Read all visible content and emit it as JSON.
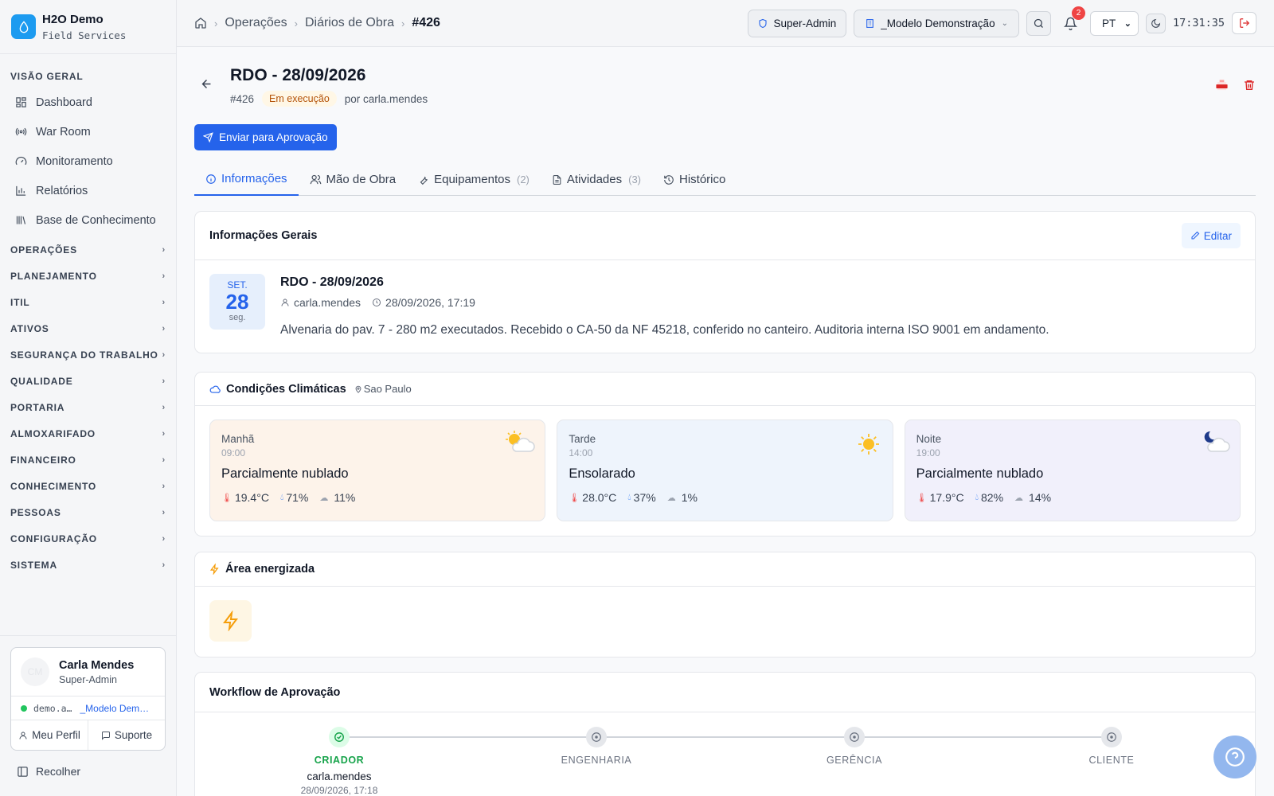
{
  "brand": {
    "name": "H2O Demo",
    "subtitle": "Field Services"
  },
  "sidebar": {
    "overview_label": "VISÃO GERAL",
    "overview_items": [
      {
        "label": "Dashboard",
        "icon": "dashboard-icon"
      },
      {
        "label": "War Room",
        "icon": "broadcast-icon"
      },
      {
        "label": "Monitoramento",
        "icon": "gauge-icon"
      },
      {
        "label": "Relatórios",
        "icon": "bar-chart-icon"
      },
      {
        "label": "Base de Conhecimento",
        "icon": "library-icon"
      }
    ],
    "sections": [
      "OPERAÇÕES",
      "PLANEJAMENTO",
      "ITIL",
      "ATIVOS",
      "SEGURANÇA DO TRABALHO",
      "QUALIDADE",
      "PORTARIA",
      "ALMOXARIFADO",
      "FINANCEIRO",
      "CONHECIMENTO",
      "PESSOAS",
      "CONFIGURAÇÃO",
      "SISTEMA"
    ],
    "user": {
      "initials": "CM",
      "name": "Carla Mendes",
      "role": "Super-Admin",
      "account": "demo.a…",
      "tenant": "_Modelo Dem…",
      "profile_link": "Meu Perfil",
      "support_link": "Suporte"
    },
    "collapse_label": "Recolher"
  },
  "topbar": {
    "breadcrumb": [
      "Operações",
      "Diários de Obra",
      "#426"
    ],
    "role_chip": "Super-Admin",
    "tenant_chip": "_Modelo Demonstração",
    "notifications_count": "2",
    "language": "PT",
    "clock": "17:31:35"
  },
  "record": {
    "title": "RDO - 28/09/2026",
    "id": "#426",
    "status": "Em execução",
    "author": "por carla.mendes",
    "submit_label": "Enviar para Aprovação"
  },
  "tabs": [
    {
      "label": "Informações",
      "count": ""
    },
    {
      "label": "Mão de Obra",
      "count": ""
    },
    {
      "label": "Equipamentos",
      "count": "(2)"
    },
    {
      "label": "Atividades",
      "count": "(3)"
    },
    {
      "label": "Histórico",
      "count": ""
    }
  ],
  "general_info": {
    "heading": "Informações Gerais",
    "edit_label": "Editar",
    "date_month": "SET.",
    "date_day": "28",
    "date_weekday": "seg.",
    "title": "RDO - 28/09/2026",
    "user": "carla.mendes",
    "timestamp": "28/09/2026, 17:19",
    "description": "Alvenaria do pav. 7 - 280 m2 executados. Recebido o CA-50 da NF 45218, conferido no canteiro. Auditoria interna ISO 9001 em andamento."
  },
  "weather": {
    "heading": "Condições Climáticas",
    "location": "Sao Paulo",
    "periods": [
      {
        "period": "Manhã",
        "time": "09:00",
        "condition": "Parcialmente nublado",
        "temp": "19.4°C",
        "humidity": "71%",
        "rain": "11%",
        "icon": "sun-cloud-icon",
        "bg": "#fdf3ea"
      },
      {
        "period": "Tarde",
        "time": "14:00",
        "condition": "Ensolarado",
        "temp": "28.0°C",
        "humidity": "37%",
        "rain": "1%",
        "icon": "sun-icon",
        "bg": "#eef4fc"
      },
      {
        "period": "Noite",
        "time": "19:00",
        "condition": "Parcialmente nublado",
        "temp": "17.9°C",
        "humidity": "82%",
        "rain": "14%",
        "icon": "moon-cloud-icon",
        "bg": "#f1f0fb"
      }
    ]
  },
  "energized": {
    "heading": "Área energizada"
  },
  "workflow": {
    "heading": "Workflow de Aprovação",
    "steps": [
      {
        "label": "CRIADOR",
        "user": "carla.mendes",
        "date": "28/09/2026, 17:18",
        "done": true
      },
      {
        "label": "ENGENHARIA",
        "user": "",
        "date": "",
        "done": false
      },
      {
        "label": "GERÊNCIA",
        "user": "",
        "date": "",
        "done": false
      },
      {
        "label": "CLIENTE",
        "user": "",
        "date": "",
        "done": false
      }
    ]
  },
  "colors": {
    "accent": "#2563eb",
    "success": "#16a34a",
    "danger": "#dc2626",
    "warning": "#f59e0b"
  }
}
